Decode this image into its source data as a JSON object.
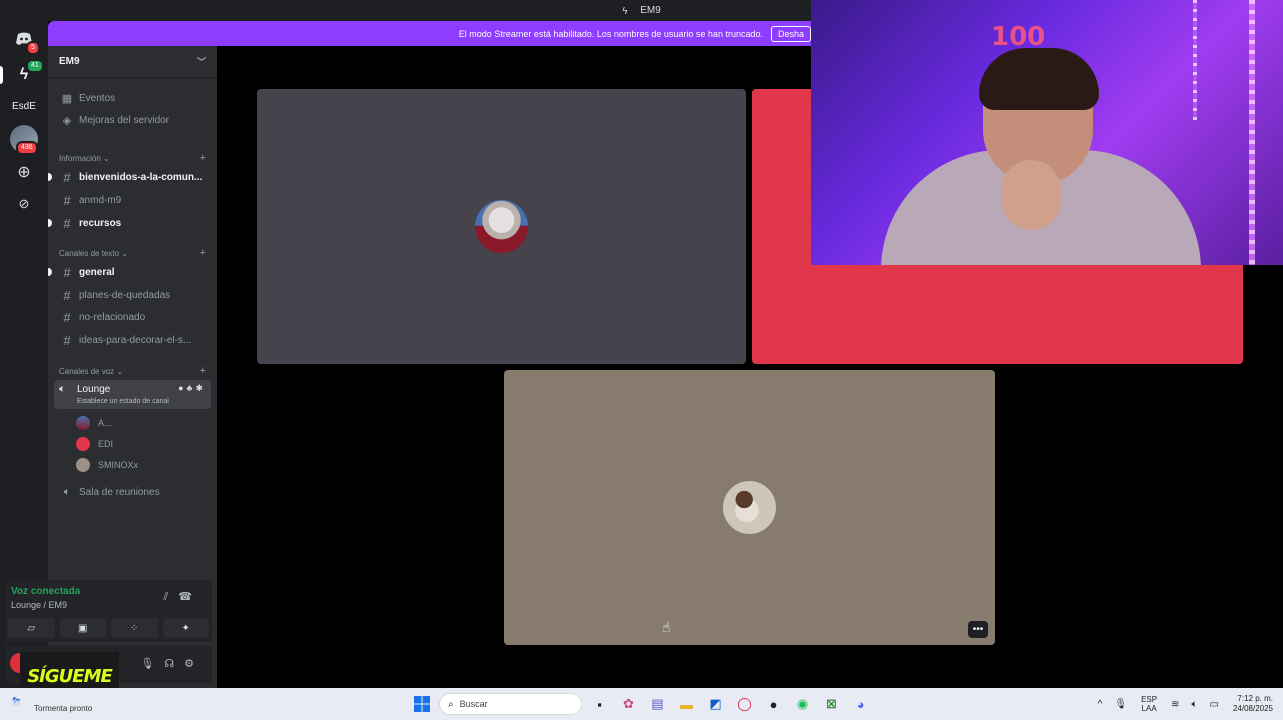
{
  "titlebar": {
    "title": "EM9"
  },
  "banner": {
    "message": "El modo Streamer está habilitado. Los nombres de usuario se han truncado.",
    "action": "Desha"
  },
  "rail": {
    "badges": {
      "dm": "5",
      "server1": "41",
      "server3": "436"
    },
    "text_server": "EsdE"
  },
  "server": {
    "name": "EM9"
  },
  "sidebar": {
    "top_items": [
      {
        "label": "Eventos",
        "icon": "calendar-icon"
      },
      {
        "label": "Mejoras del servidor",
        "icon": "boost-icon"
      }
    ],
    "categories": {
      "info": "Información",
      "text": "Canales de texto",
      "voice": "Canales de voz"
    },
    "info_channels": [
      "bienvenidos-a-la-comun...",
      "anmd-m9",
      "recursos"
    ],
    "text_channels": [
      "general",
      "planes-de-quedadas",
      "no-relacionado",
      "ideas-para-decorar-el-s..."
    ],
    "voice": {
      "lounge": {
        "name": "Lounge",
        "status": "Establece un estado de canal"
      },
      "users": [
        "A...",
        "EDI",
        "SMINOXx"
      ],
      "meeting_room": "Sala de reuniones"
    }
  },
  "voice_panel": {
    "status": "Voz conectada",
    "location": "Lounge / EM9"
  },
  "overlay": {
    "sigueme": "SÍGUEME"
  },
  "taskbar": {
    "weather": "Tormenta pronto",
    "search_placeholder": "Buscar",
    "lang_top": "ESP",
    "lang_bottom": "LAA",
    "time": "7:12 p. m.",
    "date": "24/08/2025"
  },
  "colors": {
    "accent": "#8c3dff",
    "tile_a": "#46434d",
    "tile_b": "#e0384a",
    "tile_c": "#867b6d",
    "voice_connected": "#23a55a"
  }
}
